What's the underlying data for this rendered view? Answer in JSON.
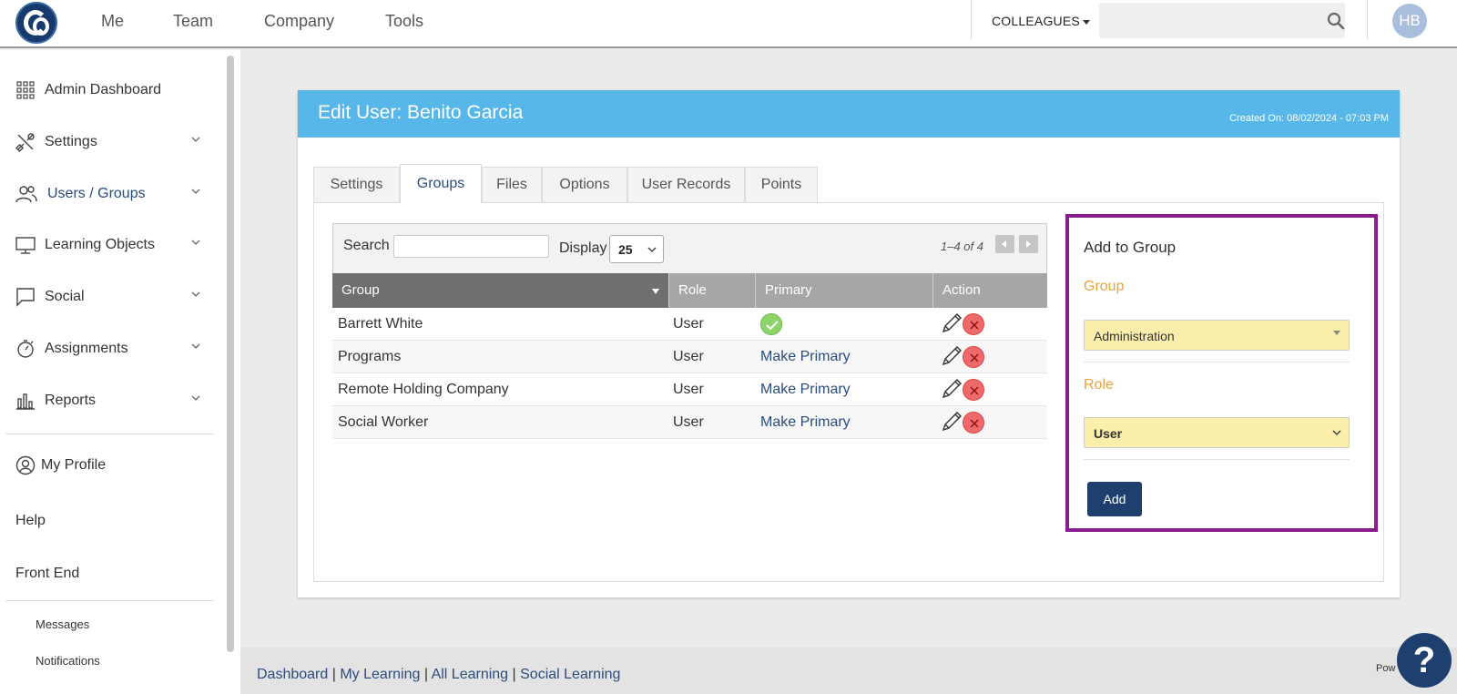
{
  "topnav": {
    "items": [
      "Me",
      "Team",
      "Company",
      "Tools"
    ],
    "colleagues_label": "COLLEAGUES",
    "search_placeholder": "",
    "avatar_initials": "HB"
  },
  "sidebar": {
    "items": [
      {
        "label": "Admin Dashboard",
        "icon": "grid-icon"
      },
      {
        "label": "Settings",
        "icon": "tools-icon"
      },
      {
        "label": "Users / Groups",
        "icon": "users-icon",
        "active": true
      },
      {
        "label": "Learning Objects",
        "icon": "monitor-icon"
      },
      {
        "label": "Social",
        "icon": "chat-bubble-icon"
      },
      {
        "label": "Assignments",
        "icon": "stopwatch-icon"
      },
      {
        "label": "Reports",
        "icon": "bar-chart-icon"
      }
    ],
    "my_profile": "My Profile",
    "help": "Help",
    "front_end": "Front End",
    "sub_items": [
      "Messages",
      "Notifications"
    ]
  },
  "card": {
    "title": "Edit User: Benito Garcia",
    "created_on": "Created On: 08/02/2024 - 07:03 PM",
    "tabs": [
      "Settings",
      "Groups",
      "Files",
      "Options",
      "User Records",
      "Points"
    ],
    "active_tab": "Groups"
  },
  "grid": {
    "search_label": "Search",
    "search_value": "",
    "display_label": "Display",
    "display_value": "25",
    "pager_text": "1–4 of 4",
    "columns": [
      "Group",
      "Role",
      "Primary",
      "Action"
    ],
    "rows": [
      {
        "group": "Barrett White",
        "role": "User",
        "primary": "",
        "is_primary": true
      },
      {
        "group": "Programs",
        "role": "User",
        "primary": "Make Primary",
        "is_primary": false
      },
      {
        "group": "Remote Holding Company",
        "role": "User",
        "primary": "Make Primary",
        "is_primary": false
      },
      {
        "group": "Social Worker",
        "role": "User",
        "primary": "Make Primary",
        "is_primary": false
      }
    ]
  },
  "add_group": {
    "title": "Add to Group",
    "group_label": "Group",
    "group_value": "Administration",
    "role_label": "Role",
    "role_value": "User",
    "add_button": "Add"
  },
  "footer": {
    "links": [
      "Dashboard",
      "My Learning",
      "All Learning",
      "Social Learning"
    ],
    "separator": "|",
    "powered": "Pow"
  },
  "help_fab": "?",
  "colors": {
    "header_blue": "#58b7e9",
    "navy": "#1f3f6e",
    "link": "#2b4c7e",
    "orange_label": "#e8a33a",
    "highlight_border": "#8a1d8d",
    "select_fill": "#fbeeab"
  }
}
